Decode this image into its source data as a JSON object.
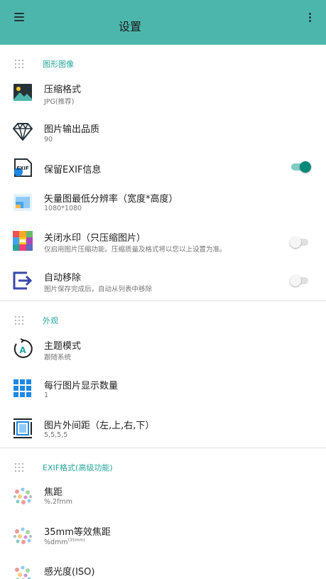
{
  "appbar": {
    "title": "设置"
  },
  "sections": {
    "image": {
      "label": "图形图像"
    },
    "appearance": {
      "label": "外观"
    },
    "exif": {
      "label": "EXIF格式(高级功能)"
    }
  },
  "items": {
    "compress_format": {
      "title": "压缩格式",
      "subtitle": "JPG(推荐)"
    },
    "output_quality": {
      "title": "图片输出品质",
      "subtitle": "90"
    },
    "keep_exif": {
      "title": "保留EXIF信息",
      "enabled": true
    },
    "vector_min_res": {
      "title": "矢量图最低分辨率（宽度*高度）",
      "subtitle": "1080*1080"
    },
    "close_watermark": {
      "title": "关闭水印（只压缩图片）",
      "subtitle": "仅启用图片压缩功能。压缩质量及格式将以您以上设置为准。",
      "enabled": false
    },
    "auto_remove": {
      "title": "自动移除",
      "subtitle": "图片保存完成后，自动从列表中移除",
      "enabled": false
    },
    "theme_mode": {
      "title": "主题模式",
      "subtitle": "跟随系统"
    },
    "per_row": {
      "title": "每行图片显示数量",
      "subtitle": "1"
    },
    "margin": {
      "title": "图片外间距（左,上,右,下）",
      "subtitle": "5,5,5,5"
    },
    "focal": {
      "title": "焦距",
      "subtitle": "%.2fmm"
    },
    "focal35": {
      "title": "35mm等效焦距",
      "subtitle": "%dmm",
      "subtitle_sup": "(35mm)"
    },
    "iso": {
      "title": "感光度(ISO)"
    }
  },
  "icons": {
    "exif_badge": "EXIF"
  },
  "colors": {
    "accent": "#26A69A",
    "appbar": "#4DB6AC",
    "toggle_on": "#00897B"
  }
}
